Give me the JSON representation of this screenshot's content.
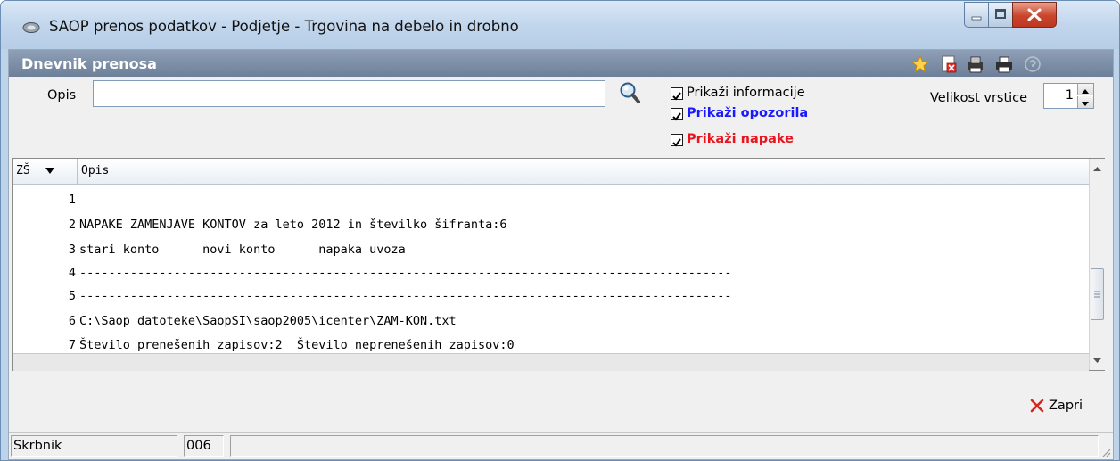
{
  "window": {
    "title": "SAOP prenos podatkov - Podjetje - Trgovina na debelo in drobno"
  },
  "panel": {
    "title": "Dnevnik prenosa"
  },
  "toolbar": {
    "icons": [
      "star-icon",
      "delete-document-icon",
      "print-preview-icon",
      "printer-icon",
      "help-icon"
    ]
  },
  "filter": {
    "opis_label": "Opis",
    "opis_value": ""
  },
  "options": {
    "info_label": "Prikaži informacije",
    "info_checked": true,
    "warnings_label": "Prikaži opozorila",
    "warnings_checked": true,
    "warnings_color": "#1a1aff",
    "errors_label": "Prikaži napake",
    "errors_checked": true,
    "errors_color": "#e8141e"
  },
  "row_size": {
    "label": "Velikost vrstice",
    "value": "1"
  },
  "grid": {
    "columns": [
      "ZŠ",
      "Opis"
    ],
    "rows": [
      {
        "num": "1",
        "text": ""
      },
      {
        "num": "2",
        "text": "NAPAKE ZAMENJAVE KONTOV za leto 2012 in številko šifranta:6"
      },
      {
        "num": "3",
        "text": "stari konto      novi konto      napaka uvoza"
      },
      {
        "num": "4",
        "text": "------------------------------------------------------------------------------------------"
      },
      {
        "num": "5",
        "text": "------------------------------------------------------------------------------------------"
      },
      {
        "num": "6",
        "text": "C:\\Saop datoteke\\SaopSI\\saop2005\\icenter\\ZAM-KON.txt"
      },
      {
        "num": "7",
        "text": "Število prenešenih zapisov:2  Število neprenešenih zapisov:0"
      }
    ]
  },
  "actions": {
    "close_label": "Zapri"
  },
  "status": {
    "user": "Skrbnik",
    "code": "006",
    "extra": ""
  }
}
